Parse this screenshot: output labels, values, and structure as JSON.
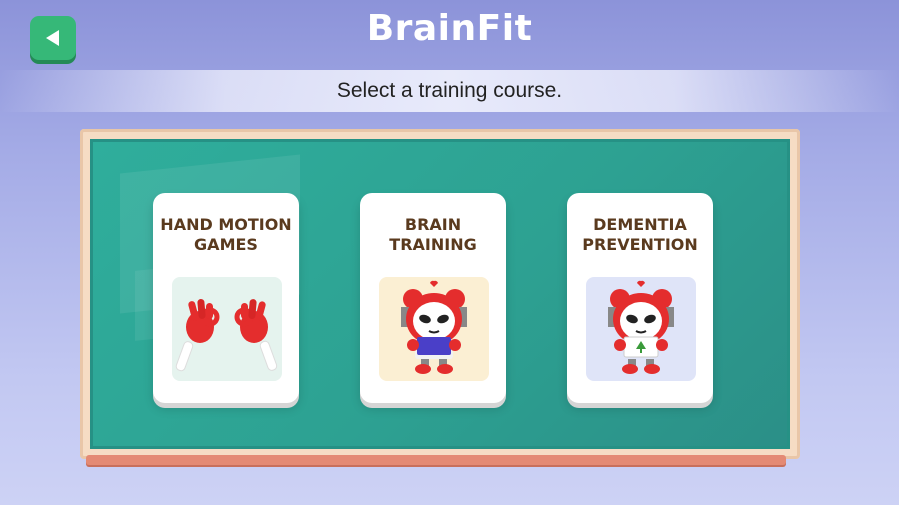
{
  "header": {
    "back_icon": "back-arrow-icon",
    "title": "BrainFit",
    "subtitle": "Select a training course."
  },
  "courses": [
    {
      "title": "HAND MOTION\nGAMES",
      "image": "hand-gestures-icon",
      "bg": "#e5f3ee"
    },
    {
      "title": "BRAIN\nTRAINING",
      "image": "alarm-clock-mascot-reading-icon",
      "bg": "#fbefd3"
    },
    {
      "title": "DEMENTIA\nPREVENTION",
      "image": "alarm-clock-mascot-sign-icon",
      "bg": "#dfe4f8"
    }
  ],
  "colors": {
    "accent": "#36b878",
    "board": "#2fae9c",
    "card_title": "#5a3a1e"
  }
}
